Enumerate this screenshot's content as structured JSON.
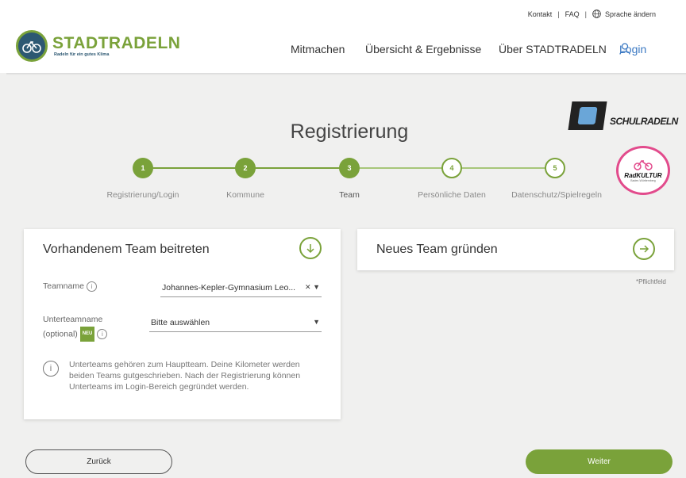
{
  "header": {
    "contact": "Kontakt",
    "faq": "FAQ",
    "language": "Sprache ändern",
    "logo_title": "STADTRADELN",
    "logo_subtitle": "Radeln für ein gutes Klima",
    "nav": [
      "Mitmachen",
      "Übersicht & Ergebnisse",
      "Über STADTRADELN"
    ],
    "login": "Login"
  },
  "partners": {
    "schulradeln": "SCHULRADELN",
    "radkultur": "RadKULTUR",
    "radkultur_sub": "Baden-Württemberg"
  },
  "page_title": "Registrierung",
  "steps": [
    {
      "number": "1",
      "label": "Registrierung/Login",
      "state": "done"
    },
    {
      "number": "2",
      "label": "Kommune",
      "state": "done"
    },
    {
      "number": "3",
      "label": "Team",
      "state": "current"
    },
    {
      "number": "4",
      "label": "Persönliche Daten",
      "state": "todo"
    },
    {
      "number": "5",
      "label": "Datenschutz/Spielregeln",
      "state": "todo"
    }
  ],
  "join_team": {
    "title": "Vorhandenem Team beitreten",
    "teamname_label": "Teamname",
    "teamname_value": "Johannes-Kepler-Gymnasium Leo...",
    "subteam_label_1": "Unterteamname",
    "subteam_label_2": "(optional)",
    "new_badge": "NEU",
    "subteam_value": "Bitte auswählen",
    "hint": "Unterteams gehören zum Hauptteam. Deine Kilometer werden beiden Teams gutgeschrieben. Nach der Registrierung können Unterteams im Login-Bereich gegründet werden."
  },
  "new_team": {
    "title": "Neues Team gründen"
  },
  "required_note": "*Pflichtfeld",
  "buttons": {
    "back": "Zurück",
    "next": "Weiter"
  },
  "colors": {
    "accent": "#7aa23a",
    "link": "#3a78c2",
    "background": "#f0f0ef"
  }
}
